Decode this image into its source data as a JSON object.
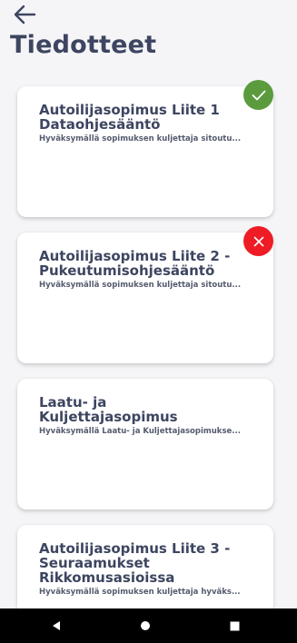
{
  "header": {
    "back_icon": "arrow-left-icon",
    "title": "Tiedotteet"
  },
  "notices": [
    {
      "title": "Autoilijasopimus Liite 1 Dataohjesääntö",
      "description": "Hyväksymällä sopimuksen kuljettaja sitoutu...",
      "status": "approved",
      "status_icon": "check-icon",
      "status_color": "#5c9a3e"
    },
    {
      "title": "Autoilijasopimus Liite 2 - Pukeutumisohjesääntö",
      "description": "Hyväksymällä sopimuksen kuljettaja sitoutu...",
      "status": "rejected",
      "status_icon": "close-icon",
      "status_color": "#ee1c25"
    },
    {
      "title": "Laatu- ja Kuljettajasopimus",
      "description": "Hyväksymällä Laatu- ja Kuljettajasopimukse..."
    },
    {
      "title": "Autoilijasopimus Liite 3 - Seuraamukset Rikkomusasioissa",
      "description": "Hyväksymällä sopimuksen kuljettaja hyväks..."
    }
  ],
  "system_nav": {
    "back_icon": "triangle-back-icon",
    "home_icon": "circle-home-icon",
    "recents_icon": "square-recents-icon"
  },
  "colors": {
    "background": "#f5f5f7",
    "title_text": "#3d4560",
    "card_background": "#ffffff"
  }
}
